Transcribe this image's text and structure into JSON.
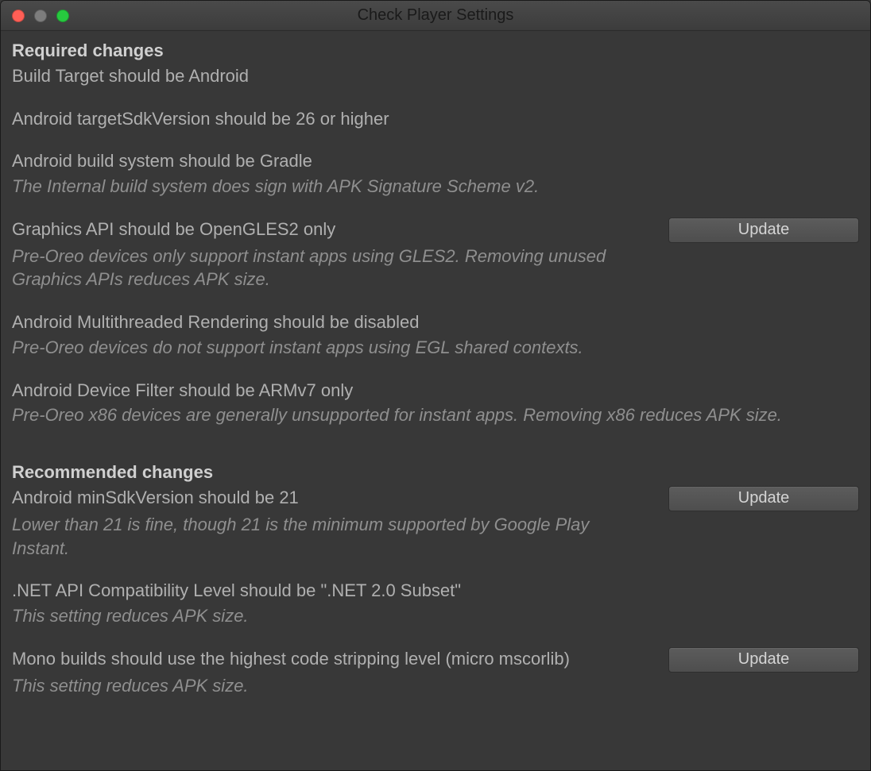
{
  "window": {
    "title": "Check Player Settings"
  },
  "buttons": {
    "update": "Update"
  },
  "sections": {
    "required": {
      "heading": "Required changes",
      "items": [
        {
          "title": "Build Target should be Android",
          "desc": null,
          "has_button": false
        },
        {
          "title": "Android targetSdkVersion should be 26 or higher",
          "desc": null,
          "has_button": false
        },
        {
          "title": "Android build system should be Gradle",
          "desc": "The Internal build system does sign with APK Signature Scheme v2.",
          "has_button": false
        },
        {
          "title": "Graphics API should be OpenGLES2 only",
          "desc": "Pre-Oreo devices only support instant apps using GLES2. Removing unused Graphics APIs reduces APK size.",
          "has_button": true
        },
        {
          "title": "Android Multithreaded Rendering should be disabled",
          "desc": "Pre-Oreo devices do not support instant apps using EGL shared contexts.",
          "has_button": false
        },
        {
          "title": "Android Device Filter should be ARMv7 only",
          "desc": "Pre-Oreo x86 devices are generally unsupported for instant apps. Removing x86 reduces APK size.",
          "has_button": false
        }
      ]
    },
    "recommended": {
      "heading": "Recommended changes",
      "items": [
        {
          "title": "Android minSdkVersion should be 21",
          "desc": "Lower than 21 is fine, though 21 is the minimum supported by Google Play Instant.",
          "has_button": true
        },
        {
          "title": ".NET API Compatibility Level should be \".NET 2.0 Subset\"",
          "desc": "This setting reduces APK size.",
          "has_button": false
        },
        {
          "title": "Mono builds should use the highest code stripping level (micro mscorlib)",
          "desc": "This setting reduces APK size.",
          "has_button": true
        }
      ]
    }
  }
}
